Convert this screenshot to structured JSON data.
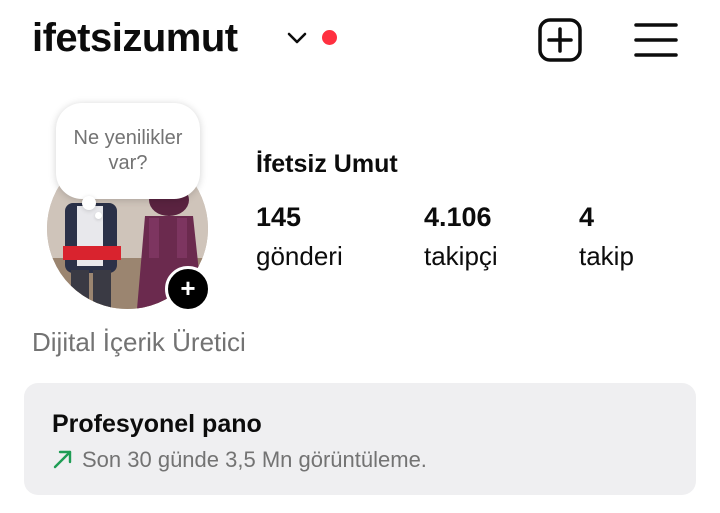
{
  "header": {
    "username": "ifetsizumut",
    "chevron_icon": "chevron-down-icon",
    "live_dot_color": "#ff3040",
    "new_post_icon": "plus-square-icon",
    "menu_icon": "hamburger-menu-icon"
  },
  "note": {
    "text": "Ne yenilikler var?"
  },
  "profile": {
    "full_name": "İfetsiz Umut",
    "add_story_symbol": "+",
    "category": "Dijital İçerik Üretici"
  },
  "stats": {
    "posts": {
      "value": "145",
      "label": "gönderi"
    },
    "followers": {
      "value": "4.106",
      "label": "takipçi"
    },
    "following": {
      "value": "4",
      "label": "takip"
    }
  },
  "dashboard": {
    "title": "Profesyonel pano",
    "subtitle": "Son 30 günde 3,5 Mn görüntüleme.",
    "trend_icon": "trending-up-arrow-icon",
    "trend_color": "#1f9d55",
    "card_color": "#efeff1"
  }
}
